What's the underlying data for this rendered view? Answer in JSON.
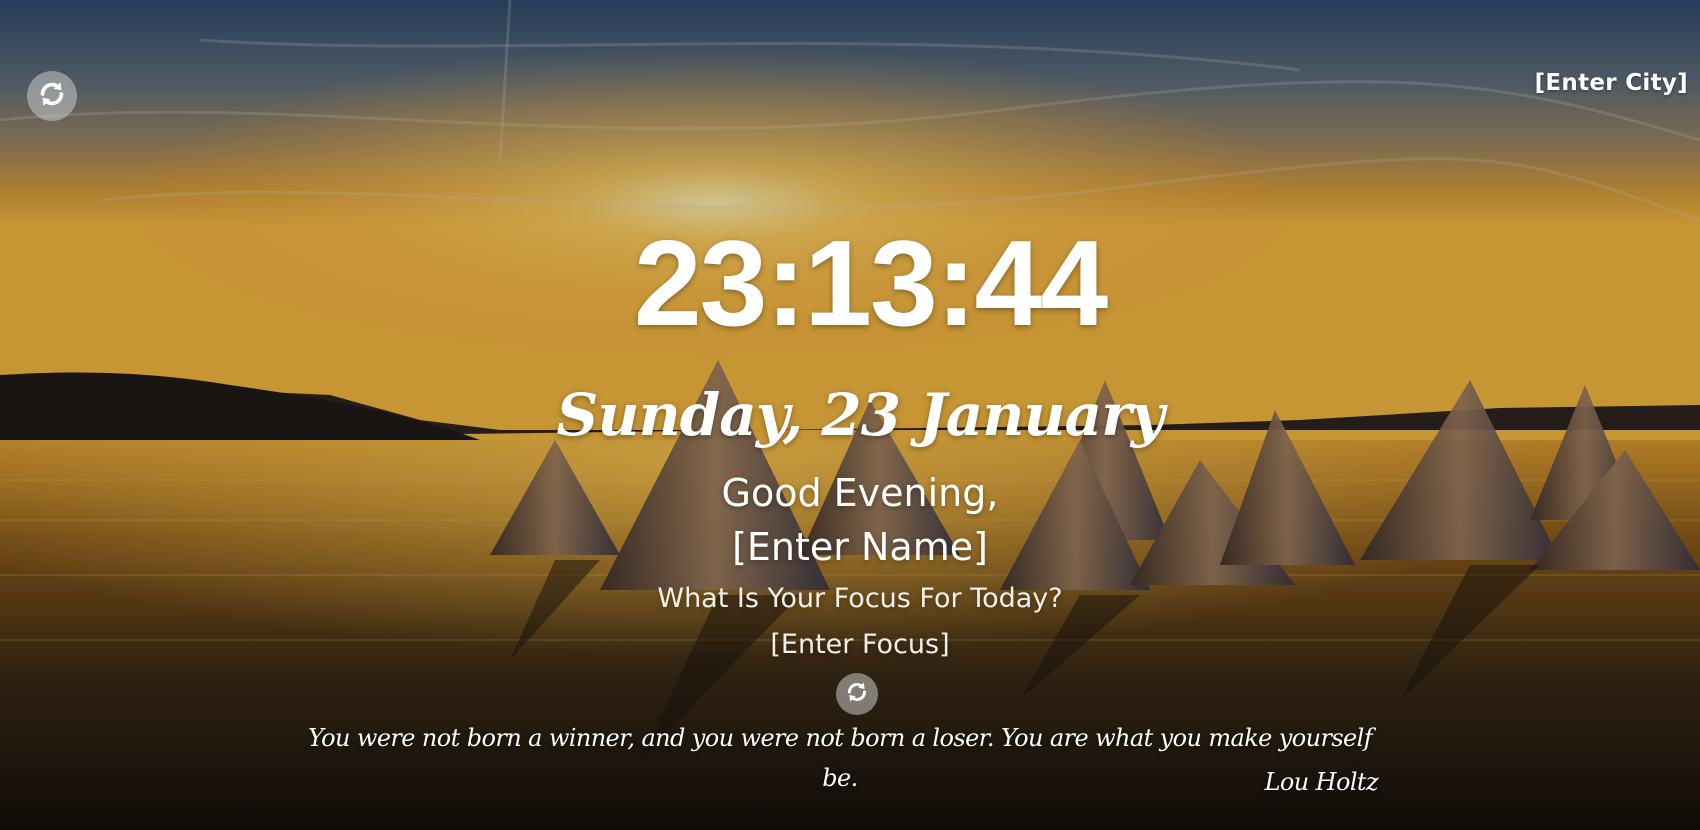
{
  "weather": {
    "city_placeholder": "[Enter City]"
  },
  "clock": {
    "time": "23:13:44",
    "date": "Sunday, 23 January"
  },
  "greeting": {
    "text": "Good Evening,",
    "name_placeholder": "[Enter Name]"
  },
  "focus": {
    "question": "What Is Your Focus For Today?",
    "placeholder": "[Enter Focus]"
  },
  "quote": {
    "text": "You were not born a winner, and you were not born a loser. You are what you make yourself be.",
    "author": "Lou Holtz"
  },
  "icons": {
    "background_refresh": "refresh-icon",
    "quote_refresh": "refresh-icon"
  },
  "colors": {
    "text": "#ffffff",
    "button_bg": "rgba(200,200,200,0.55)"
  }
}
